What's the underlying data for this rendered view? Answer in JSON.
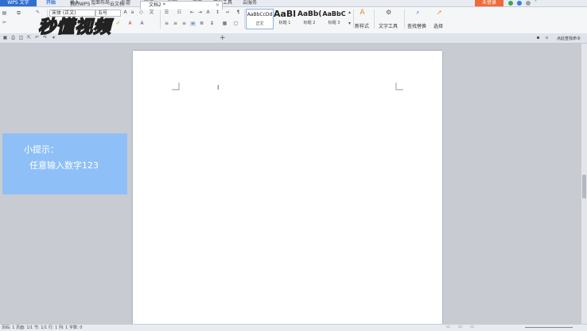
{
  "menubar": {
    "app_button": "WPS 文字",
    "tabs": [
      "开始",
      "插入",
      "页面布局",
      "引用",
      "审阅",
      "视图",
      "章节",
      "开发工具",
      "云服务"
    ],
    "login": "未登录"
  },
  "ribbon": {
    "font_name": "宋体 (正文)",
    "font_size": "五号",
    "styles": [
      {
        "sample": "AaBbCcDd",
        "label": "正文"
      },
      {
        "sample": "AaBl",
        "label": "标题 1"
      },
      {
        "sample": "AaBb(",
        "label": "标题 2"
      },
      {
        "sample": "AaBbC",
        "label": "标题 3"
      }
    ],
    "new_style": "新样式",
    "text_tools": "文字工具",
    "find_replace": "查找替换",
    "select": "选择"
  },
  "tabbar": {
    "tabs": [
      "我的WPS",
      "云文档",
      "文档2 *"
    ],
    "search_hint": "点此查找命令"
  },
  "tip": {
    "title": "小提示：",
    "body": "任意输入数字123"
  },
  "watermark": "秒懂视频",
  "statusbar": {
    "left": "页码: 1  页面: 1/1  节: 1/1  行: 1  列: 1  字数: 0"
  },
  "colors": {
    "accent": "#2f6fd0",
    "tip_bg": "#8ec0f7",
    "login": "#ef6a3a"
  }
}
